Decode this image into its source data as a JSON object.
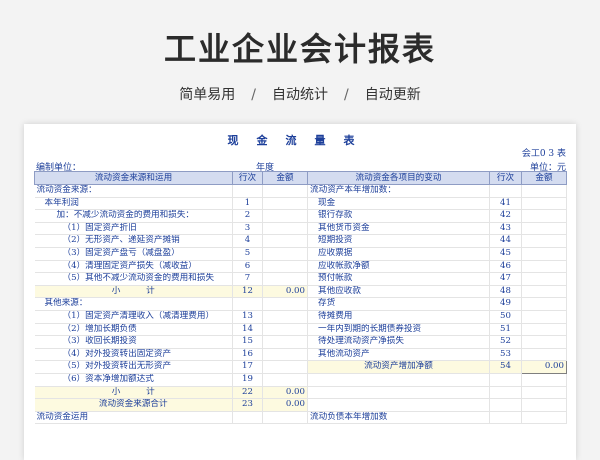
{
  "hero": {
    "title": "工业企业会计报表",
    "tags": [
      "简单易用",
      "自动统计",
      "自动更新"
    ],
    "separator": "/"
  },
  "report": {
    "title": "现金流量表",
    "form_code": "会工0 3 表",
    "compiler_label": "编制单位：",
    "year_label": "年度",
    "unit_label": "单位：元"
  },
  "headers": {
    "left_item": "流动资金来源和运用",
    "left_row": "行次",
    "left_amount": "金额",
    "right_item": "流动资金各项目的变动",
    "right_row": "行次",
    "right_amount": "金额"
  },
  "rows": [
    {
      "l": "流动资金来源：",
      "li": 0,
      "ln": "",
      "la": "",
      "lh": false,
      "r": "流动资产本年增加数：",
      "ri": 0,
      "rn": "",
      "ra": "",
      "rh": false
    },
    {
      "l": "本年利润",
      "li": 1,
      "ln": "1",
      "la": "",
      "lh": false,
      "r": "现金",
      "ri": 1,
      "rn": "41",
      "ra": "",
      "rh": false
    },
    {
      "l": "加：不减少流动资金的费用和损失：",
      "li": 2,
      "ln": "2",
      "la": "",
      "lh": false,
      "r": "银行存款",
      "ri": 1,
      "rn": "42",
      "ra": "",
      "rh": false
    },
    {
      "l": "（1）固定资产折旧",
      "li": 3,
      "ln": "3",
      "la": "",
      "lh": false,
      "r": "其他货币资金",
      "ri": 1,
      "rn": "43",
      "ra": "",
      "rh": false
    },
    {
      "l": "（2）无形资产、递延资产摊销",
      "li": 3,
      "ln": "4",
      "la": "",
      "lh": false,
      "r": "短期投资",
      "ri": 1,
      "rn": "44",
      "ra": "",
      "rh": false
    },
    {
      "l": "（3）固定资产盘亏（减盘盈）",
      "li": 3,
      "ln": "5",
      "la": "",
      "lh": false,
      "r": "应收票据",
      "ri": 1,
      "rn": "45",
      "ra": "",
      "rh": false
    },
    {
      "l": "（4）清理固定资产损失（减收益）",
      "li": 3,
      "ln": "6",
      "la": "",
      "lh": false,
      "r": "应收帐款净额",
      "ri": 1,
      "rn": "46",
      "ra": "",
      "rh": false
    },
    {
      "l": "（5）其他不减少流动资金的费用和损失",
      "li": 3,
      "ln": "7",
      "la": "",
      "lh": false,
      "r": "预付帐款",
      "ri": 1,
      "rn": "47",
      "ra": "",
      "rh": false
    },
    {
      "l": "小　　　计",
      "li": -1,
      "ln": "12",
      "la": "0.00",
      "lh": true,
      "r": "其他应收款",
      "ri": 1,
      "rn": "48",
      "ra": "",
      "rh": false
    },
    {
      "l": "其他来源：",
      "li": 1,
      "ln": "",
      "la": "",
      "lh": false,
      "r": "存货",
      "ri": 1,
      "rn": "49",
      "ra": "",
      "rh": false
    },
    {
      "l": "（1）固定资产清理收入（减清理费用）",
      "li": 3,
      "ln": "13",
      "la": "",
      "lh": false,
      "r": "待摊费用",
      "ri": 1,
      "rn": "50",
      "ra": "",
      "rh": false
    },
    {
      "l": "（2）增加长期负债",
      "li": 3,
      "ln": "14",
      "la": "",
      "lh": false,
      "r": "一年内到期的长期债券投资",
      "ri": 1,
      "rn": "51",
      "ra": "",
      "rh": false
    },
    {
      "l": "（3）收回长期投资",
      "li": 3,
      "ln": "15",
      "la": "",
      "lh": false,
      "r": "待处理流动资产净损失",
      "ri": 1,
      "rn": "52",
      "ra": "",
      "rh": false
    },
    {
      "l": "（4）对外投资转出固定资产",
      "li": 3,
      "ln": "16",
      "la": "",
      "lh": false,
      "r": "其他流动资产",
      "ri": 1,
      "rn": "53",
      "ra": "",
      "rh": false
    },
    {
      "l": "（5）对外投资转出无形资产",
      "li": 3,
      "ln": "17",
      "la": "",
      "lh": false,
      "r": "流动资产增加净额",
      "ri": -1,
      "rn": "54",
      "ra": "0.00",
      "rh": true
    },
    {
      "l": "（6）资本净增加额达式",
      "li": 3,
      "ln": "19",
      "la": "",
      "lh": false,
      "r": "",
      "ri": 0,
      "rn": "",
      "ra": "",
      "rh": false
    },
    {
      "l": "小　　　计",
      "li": -1,
      "ln": "22",
      "la": "0.00",
      "lh": true,
      "r": "",
      "ri": 0,
      "rn": "",
      "ra": "",
      "rh": false
    },
    {
      "l": "流动资金来源合计",
      "li": -1,
      "ln": "23",
      "la": "0.00",
      "lh": true,
      "r": "",
      "ri": 0,
      "rn": "",
      "ra": "",
      "rh": false
    },
    {
      "l": "流动资金运用",
      "li": 0,
      "ln": "",
      "la": "",
      "lh": false,
      "r": "流动负债本年增加数",
      "ri": 0,
      "rn": "",
      "ra": "",
      "rh": false
    }
  ]
}
